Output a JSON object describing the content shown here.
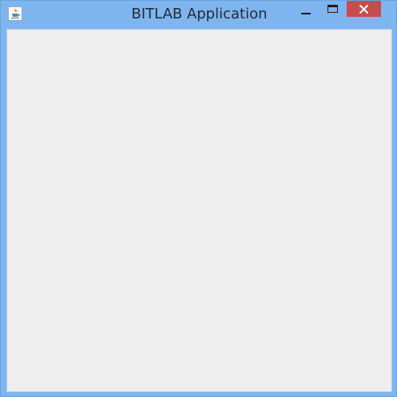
{
  "window": {
    "title": "BITLAB Application",
    "icon": "java-cup-icon",
    "controls": {
      "minimize": "minimize-icon",
      "maximize": "maximize-icon",
      "close": "close-icon"
    },
    "colors": {
      "frame": "#7fb5ee",
      "close_button": "#c74c4f",
      "content_background": "#eeeeee"
    }
  }
}
